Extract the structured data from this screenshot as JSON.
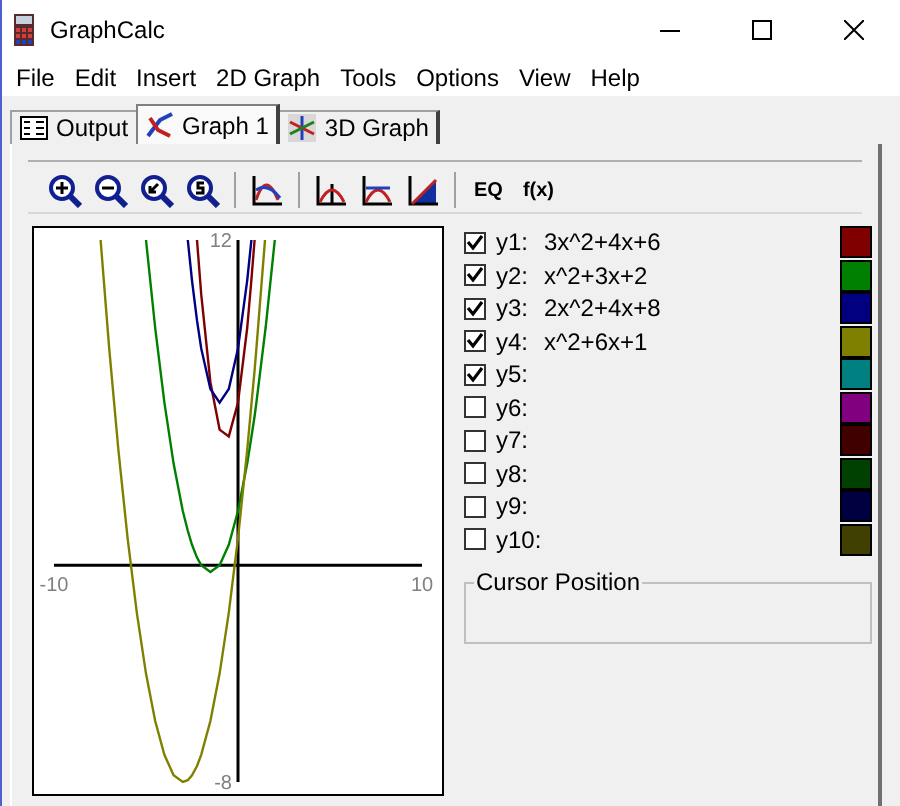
{
  "window": {
    "title": "GraphCalc"
  },
  "menu": [
    "File",
    "Edit",
    "Insert",
    "2D Graph",
    "Tools",
    "Options",
    "View",
    "Help"
  ],
  "tabs": [
    {
      "label": "Output",
      "kind": "output",
      "selected": false
    },
    {
      "label": "Graph 1",
      "kind": "graph2d",
      "selected": true
    },
    {
      "label": "3D Graph",
      "kind": "graph3d",
      "selected": false
    }
  ],
  "toolbar": [
    {
      "kind": "zoom-in"
    },
    {
      "kind": "zoom-out"
    },
    {
      "kind": "zoom-back"
    },
    {
      "kind": "zoom-standard"
    },
    {
      "kind": "separator"
    },
    {
      "kind": "graph-area"
    },
    {
      "kind": "separator"
    },
    {
      "kind": "graph-axes"
    },
    {
      "kind": "graph-curve"
    },
    {
      "kind": "graph-fill"
    },
    {
      "kind": "separator"
    },
    {
      "kind": "text",
      "label": "EQ"
    },
    {
      "kind": "text",
      "label": "f(x)"
    }
  ],
  "graph": {
    "chart_data": {
      "type": "line",
      "xlim": [
        -10,
        10
      ],
      "ylim": [
        -8,
        12
      ],
      "xticks": [
        {
          "value": -10,
          "label": "-10"
        },
        {
          "value": 10,
          "label": "10"
        }
      ],
      "yticks": [
        {
          "value": -8,
          "label": "-8"
        },
        {
          "value": 12,
          "label": "12"
        }
      ],
      "x": [
        -7.472,
        -7,
        -6.5,
        -6,
        -5.5,
        -5,
        -4.5,
        -4,
        -3.5,
        -3,
        -2.732,
        -2.5,
        -2.23,
        -2,
        -1.5,
        -1,
        -0.5,
        0,
        0.5,
        0.732,
        0.897,
        1,
        1.472,
        1.5,
        2
      ],
      "series": [
        {
          "color": "#800000",
          "values": [
            null,
            null,
            null,
            null,
            null,
            null,
            null,
            null,
            null,
            null,
            null,
            null,
            12,
            10,
            6.75,
            5,
            4.75,
            6,
            8.75,
            10.54,
            12,
            null,
            null,
            null,
            null
          ]
        },
        {
          "color": "#008000",
          "values": [
            null,
            null,
            null,
            null,
            null,
            12,
            8.75,
            6,
            3.75,
            2,
            1.27,
            0.75,
            0.28,
            0,
            -0.25,
            0,
            0.75,
            2,
            3.75,
            4.73,
            5.5,
            6,
            8.58,
            8.75,
            12
          ]
        },
        {
          "color": "#000080",
          "values": [
            null,
            null,
            null,
            null,
            null,
            null,
            null,
            null,
            null,
            null,
            12,
            10.5,
            9.03,
            8,
            6.5,
            6,
            6.5,
            8,
            10.5,
            12,
            null,
            null,
            null,
            null,
            null
          ]
        },
        {
          "color": "#808000",
          "values": [
            12,
            8,
            4.25,
            1,
            -1.75,
            -4,
            -5.75,
            -7,
            -7.75,
            -8,
            -7.93,
            -7.75,
            -7.41,
            -7,
            -5.75,
            -4,
            -1.75,
            1,
            4.25,
            5.93,
            7.19,
            8,
            12,
            null,
            null
          ]
        }
      ]
    }
  },
  "functions": [
    {
      "label": "y1:",
      "equation": "3x^2+4x+6",
      "checked": true,
      "color": "#800000"
    },
    {
      "label": "y2:",
      "equation": "x^2+3x+2",
      "checked": true,
      "color": "#008000"
    },
    {
      "label": "y3:",
      "equation": "2x^2+4x+8",
      "checked": true,
      "color": "#000080"
    },
    {
      "label": "y4:",
      "equation": "x^2+6x+1",
      "checked": true,
      "color": "#808000"
    },
    {
      "label": "y5:",
      "checked": true,
      "color": "#008080"
    },
    {
      "label": "y6:",
      "checked": false,
      "color": "#800080"
    },
    {
      "label": "y7:",
      "checked": false,
      "color": "#400000"
    },
    {
      "label": "y8:",
      "checked": false,
      "color": "#004000"
    },
    {
      "label": "y9:",
      "checked": false,
      "color": "#000040"
    },
    {
      "label": "y10:",
      "checked": false,
      "color": "#404000"
    }
  ],
  "cursor_position": {
    "title": "Cursor Position"
  }
}
